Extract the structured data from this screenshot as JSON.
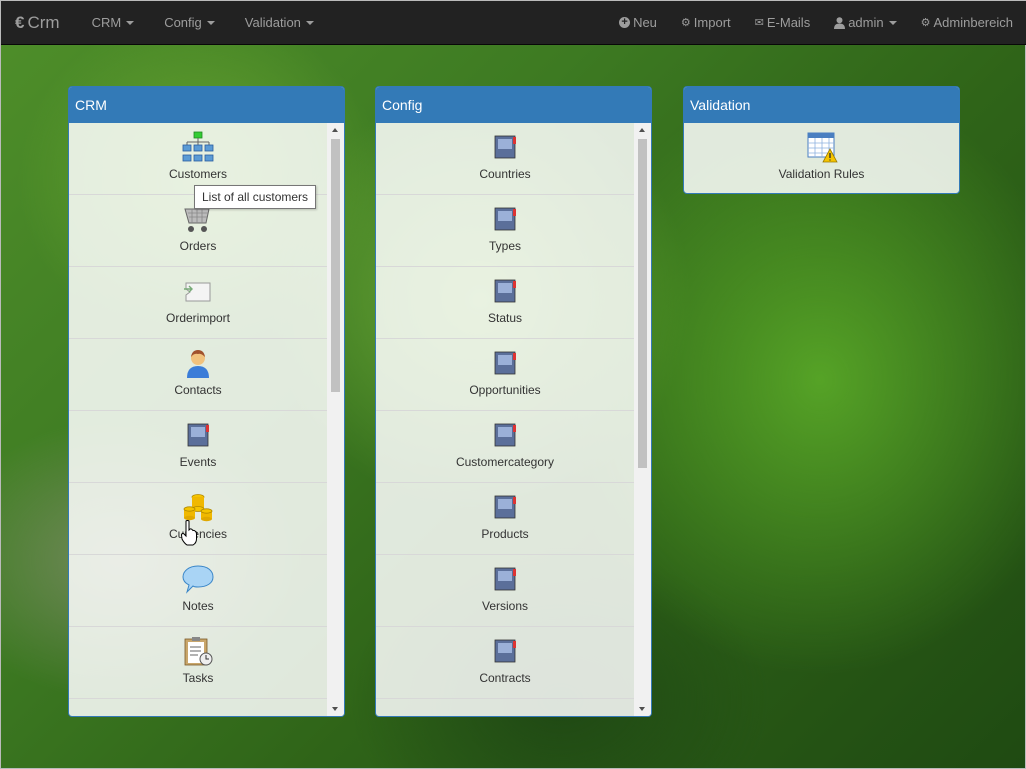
{
  "navbar": {
    "brand_icon": "€",
    "brand_text": "Crm",
    "menus": [
      {
        "label": "CRM"
      },
      {
        "label": "Config"
      },
      {
        "label": "Validation"
      }
    ],
    "right": {
      "new_label": "Neu",
      "import_label": "Import",
      "emails_label": "E-Mails",
      "user_label": "admin",
      "admin_label": "Adminbereich"
    }
  },
  "crm_panel": {
    "title": "CRM",
    "items": [
      {
        "label": "Customers",
        "icon": "hierarchy-icon"
      },
      {
        "label": "Orders",
        "icon": "cart-icon"
      },
      {
        "label": "Orderimport",
        "icon": "import-icon"
      },
      {
        "label": "Contacts",
        "icon": "person-icon"
      },
      {
        "label": "Events",
        "icon": "book-icon"
      },
      {
        "label": "Currencies",
        "icon": "coins-icon"
      },
      {
        "label": "Notes",
        "icon": "speech-bubble-icon"
      },
      {
        "label": "Tasks",
        "icon": "clipboard-icon"
      }
    ]
  },
  "config_panel": {
    "title": "Config",
    "items": [
      {
        "label": "Countries"
      },
      {
        "label": "Types"
      },
      {
        "label": "Status"
      },
      {
        "label": "Opportunities"
      },
      {
        "label": "Customercategory"
      },
      {
        "label": "Products"
      },
      {
        "label": "Versions"
      },
      {
        "label": "Contracts"
      }
    ]
  },
  "validation_panel": {
    "title": "Validation",
    "items": [
      {
        "label": "Validation Rules",
        "icon": "table-warning-icon"
      }
    ]
  },
  "tooltip": {
    "text": "List of all customers"
  },
  "colors": {
    "navbar": "#222222",
    "panel_heading": "#337ab7"
  }
}
